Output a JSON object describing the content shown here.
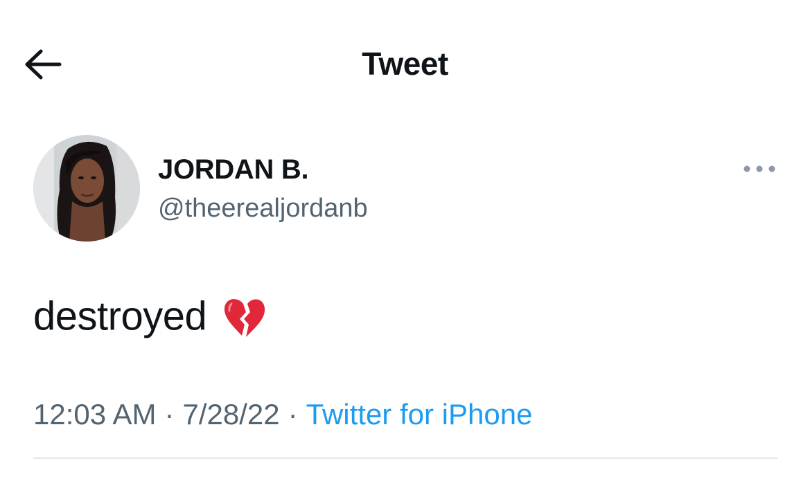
{
  "header": {
    "back_icon": "arrow-left-icon",
    "title": "Tweet"
  },
  "tweet": {
    "author": {
      "display_name": "JORDAN B.",
      "handle": "@theerealjordanb",
      "avatar": "profile-photo"
    },
    "more_icon": "more-horizontal-icon",
    "text": "destroyed",
    "emoji": "broken-heart-icon",
    "meta": {
      "time": "12:03 AM",
      "separator": "·",
      "date": "7/28/22",
      "source": "Twitter for iPhone"
    }
  },
  "colors": {
    "text_primary": "#0f1419",
    "text_secondary": "#536471",
    "link": "#1d9bf0",
    "emoji_red": "#e0283a",
    "divider": "#e4e8eb"
  }
}
